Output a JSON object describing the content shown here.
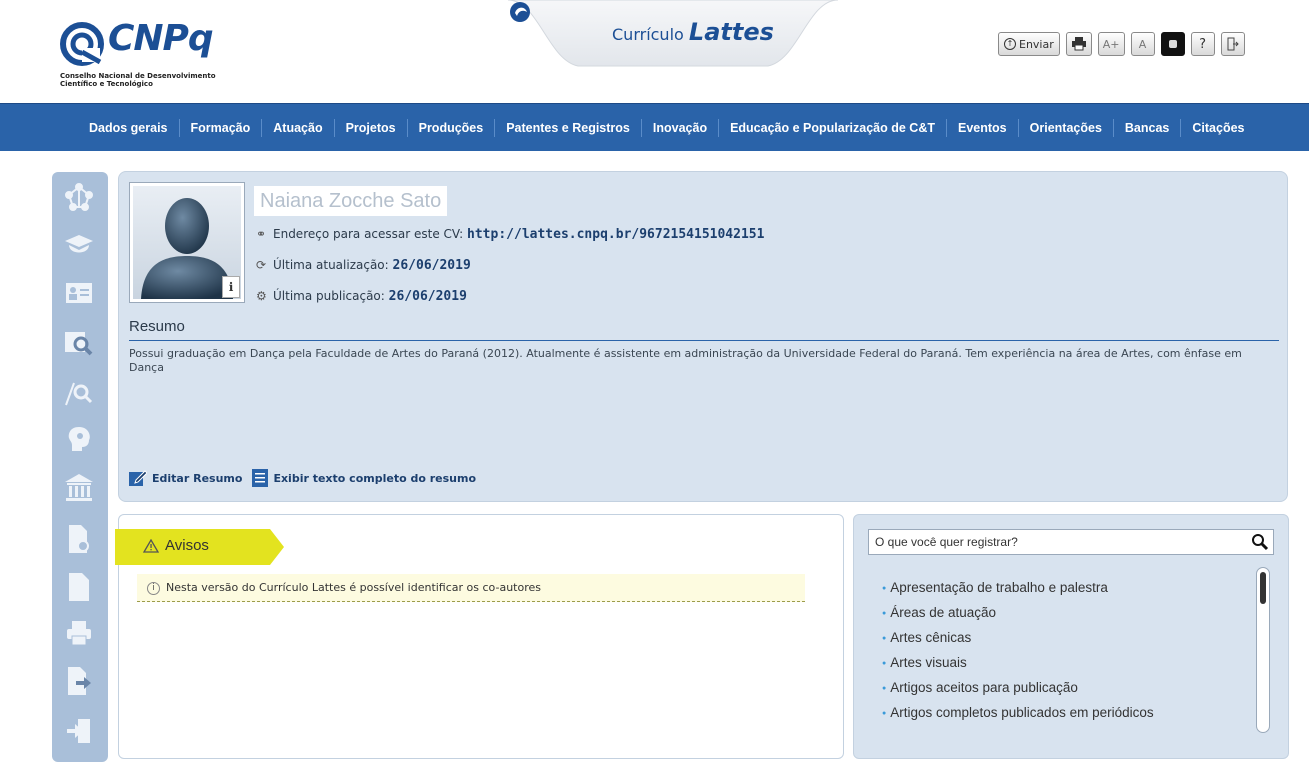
{
  "header": {
    "logo_text": "CNPq",
    "logo_sub_line1": "Conselho Nacional de Desenvolvimento",
    "logo_sub_line2": "Científico e Tecnológico",
    "app_title_prefix": "Currículo",
    "app_title_main": "Lattes",
    "toolbar": {
      "enviar_label": "Enviar",
      "print_icon": "print-icon",
      "font_increase_label": "A+",
      "font_normal_label": "A",
      "contrast_icon": "contrast-icon",
      "help_label": "?",
      "exit_icon": "exit-icon"
    }
  },
  "nav": {
    "items": [
      "Dados gerais",
      "Formação",
      "Atuação",
      "Projetos",
      "Produções",
      "Patentes e Registros",
      "Inovação",
      "Educação e Popularização de C&T",
      "Eventos",
      "Orientações",
      "Bancas",
      "Citações"
    ]
  },
  "profile": {
    "name": "Naiana Zocche Sato",
    "cv_address_label": "Endereço para acessar este CV:",
    "cv_address_url": "http://lattes.cnpq.br/9672154151042151",
    "last_update_label": "Última atualização:",
    "last_update_value": "26/06/2019",
    "last_publication_label": "Última publicação:",
    "last_publication_value": "26/06/2019",
    "resumo_title": "Resumo",
    "resumo_text": "Possui graduação em Dança pela Faculdade de Artes do Paraná (2012). Atualmente é assistente em administração da Universidade Federal do Paraná. Tem experiência na área de Artes, com ênfase em Dança",
    "edit_resumo_label": "Editar Resumo",
    "show_full_label": "Exibir texto completo do resumo"
  },
  "avisos": {
    "title": "Avisos",
    "note": "Nesta versão do Currículo Lattes é possível identificar os co-autores"
  },
  "registrar": {
    "search_placeholder": "O que você quer registrar?",
    "items": [
      "Apresentação de trabalho e palestra",
      "Áreas de atuação",
      "Artes cênicas",
      "Artes visuais",
      "Artigos aceitos para publicação",
      "Artigos completos publicados em periódicos"
    ]
  },
  "sidebar": {
    "icons": [
      "network-icon",
      "education-cap-icon",
      "id-card-icon",
      "research-icon",
      "search-analysis-icon",
      "brain-icon",
      "institution-icon",
      "document-link-icon",
      "document-icon",
      "printer-icon",
      "export-icon",
      "import-icon"
    ]
  },
  "colors": {
    "nav_blue": "#2a63a9",
    "panel_bg": "#d8e3ef",
    "sidebar_bg": "#a9bfd9",
    "avisos_tab": "#e3e31f"
  }
}
